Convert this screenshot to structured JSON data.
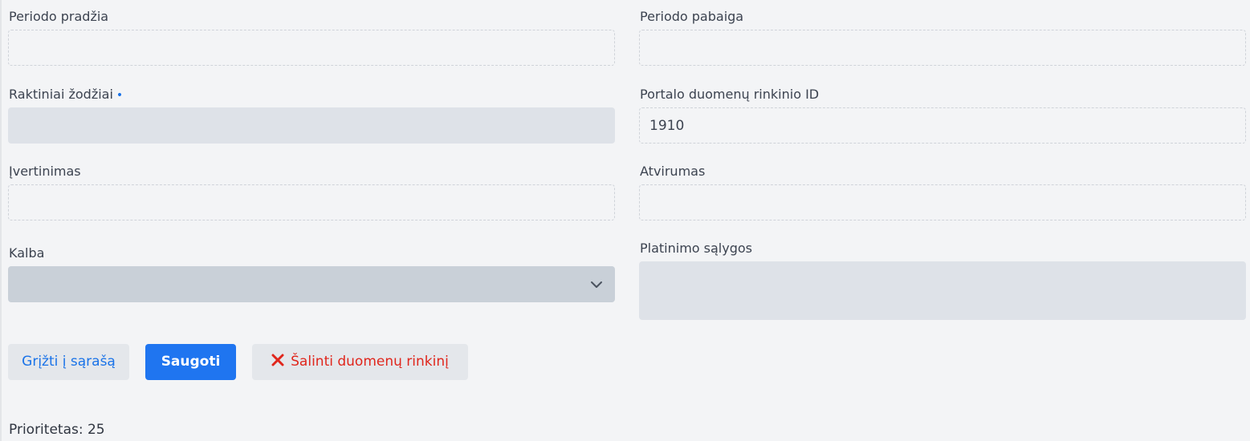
{
  "form": {
    "period_start": {
      "label": "Periodo pradžia",
      "value": ""
    },
    "period_end": {
      "label": "Periodo pabaiga",
      "value": ""
    },
    "keywords": {
      "label": "Raktiniai žodžiai",
      "required_marker": "•",
      "value": ""
    },
    "portal_dataset_id": {
      "label": "Portalo duomenų rinkinio ID",
      "value": "1910"
    },
    "rating": {
      "label": "Įvertinimas",
      "value": ""
    },
    "openness": {
      "label": "Atvirumas",
      "value": ""
    },
    "language": {
      "label": "Kalba",
      "value": "",
      "icon": "chevron-down-icon"
    },
    "distribution_terms": {
      "label": "Platinimo sąlygos",
      "value": ""
    }
  },
  "actions": {
    "back_label": "Grįžti į sąrašą",
    "save_label": "Saugoti",
    "delete_label": "Šalinti duomenų rinkinį",
    "delete_icon": "close-icon"
  },
  "footer": {
    "priority_text": "Prioritetas: 25"
  },
  "colors": {
    "primary": "#1f75f0",
    "link": "#1a73e8",
    "danger": "#e0261c",
    "background": "#f3f4f6"
  }
}
